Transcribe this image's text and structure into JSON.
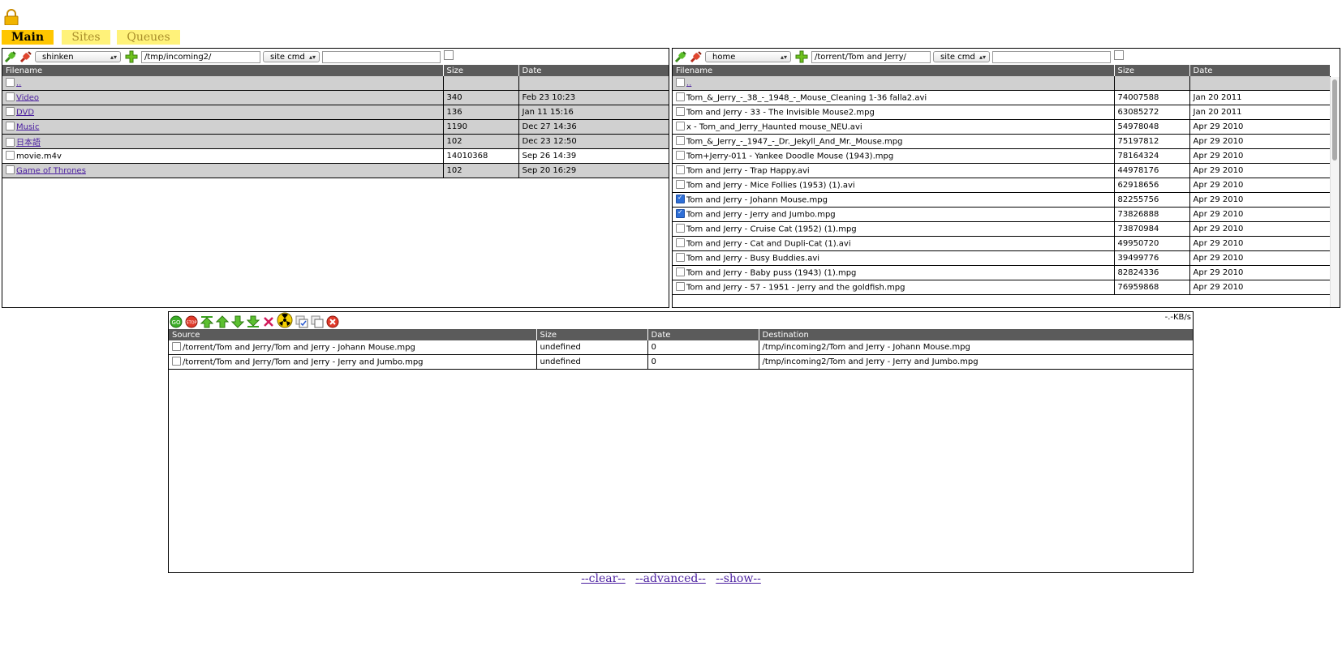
{
  "tabs": [
    {
      "label": "Main",
      "active": true
    },
    {
      "label": "Sites",
      "active": false
    },
    {
      "label": "Queues",
      "active": false
    }
  ],
  "left_panel": {
    "site": "shinken",
    "path": "/tmp/incoming2/",
    "cmd": "site cmd",
    "cmd_input": "",
    "columns": [
      "Filename",
      "Size",
      "Date"
    ],
    "parent": "..",
    "rows": [
      {
        "name": "Video",
        "size": "340",
        "date": "Feb 23 10:23",
        "dir": true
      },
      {
        "name": "DVD",
        "size": "136",
        "date": "Jan 11 15:16",
        "dir": true
      },
      {
        "name": "Music",
        "size": "1190",
        "date": "Dec 27 14:36",
        "dir": true
      },
      {
        "name": "日本語",
        "size": "102",
        "date": "Dec 23 12:50",
        "dir": true
      },
      {
        "name": "movie.m4v",
        "size": "14010368",
        "date": "Sep 26 14:39",
        "dir": false
      },
      {
        "name": "Game of Thrones",
        "size": "102",
        "date": "Sep 20 16:29",
        "dir": true
      }
    ]
  },
  "right_panel": {
    "site": "home",
    "path": "/torrent/Tom and Jerry/",
    "cmd": "site cmd",
    "cmd_input": "",
    "columns": [
      "Filename",
      "Size",
      "Date"
    ],
    "parent": "..",
    "rows": [
      {
        "name": "Tom_&_Jerry_-_38_-_1948_-_Mouse_Cleaning 1-36 falla2.avi",
        "size": "74007588",
        "date": "Jan 20 2011",
        "checked": false
      },
      {
        "name": "Tom and Jerry - 33 - The Invisible Mouse2.mpg",
        "size": "63085272",
        "date": "Jan 20 2011",
        "checked": false
      },
      {
        "name": "x - Tom_and_Jerry_Haunted mouse_NEU.avi",
        "size": "54978048",
        "date": "Apr 29 2010",
        "checked": false
      },
      {
        "name": "Tom_&_Jerry_-_1947_-_Dr._Jekyll_And_Mr._Mouse.mpg",
        "size": "75197812",
        "date": "Apr 29 2010",
        "checked": false
      },
      {
        "name": "Tom+Jerry-011 - Yankee Doodle Mouse (1943).mpg",
        "size": "78164324",
        "date": "Apr 29 2010",
        "checked": false
      },
      {
        "name": "Tom and Jerry - Trap Happy.avi",
        "size": "44978176",
        "date": "Apr 29 2010",
        "checked": false
      },
      {
        "name": "Tom and Jerry - Mice Follies (1953) (1).avi",
        "size": "62918656",
        "date": "Apr 29 2010",
        "checked": false
      },
      {
        "name": "Tom and Jerry - Johann Mouse.mpg",
        "size": "82255756",
        "date": "Apr 29 2010",
        "checked": true
      },
      {
        "name": "Tom and Jerry - Jerry and Jumbo.mpg",
        "size": "73826888",
        "date": "Apr 29 2010",
        "checked": true
      },
      {
        "name": "Tom and Jerry - Cruise Cat (1952) (1).mpg",
        "size": "73870984",
        "date": "Apr 29 2010",
        "checked": false
      },
      {
        "name": "Tom and Jerry - Cat and Dupli-Cat (1).avi",
        "size": "49950720",
        "date": "Apr 29 2010",
        "checked": false
      },
      {
        "name": "Tom and Jerry - Busy Buddies.avi",
        "size": "39499776",
        "date": "Apr 29 2010",
        "checked": false
      },
      {
        "name": "Tom and Jerry - Baby puss (1943) (1).mpg",
        "size": "82824336",
        "date": "Apr 29 2010",
        "checked": false
      },
      {
        "name": "Tom and Jerry - 57 - 1951 - Jerry and the goldfish.mpg",
        "size": "76959868",
        "date": "Apr 29 2010",
        "checked": false
      }
    ]
  },
  "queue": {
    "speed": "-.-KB/s",
    "columns": [
      "Source",
      "Size",
      "Date",
      "Destination"
    ],
    "rows": [
      {
        "source": "/torrent/Tom and Jerry/Tom and Jerry - Johann Mouse.mpg",
        "size": "undefined",
        "date": "0",
        "dest": "/tmp/incoming2/Tom and Jerry - Johann Mouse.mpg"
      },
      {
        "source": "/torrent/Tom and Jerry/Tom and Jerry - Jerry and Jumbo.mpg",
        "size": "undefined",
        "date": "0",
        "dest": "/tmp/incoming2/Tom and Jerry - Jerry and Jumbo.mpg"
      }
    ]
  },
  "footer_links": [
    "--clear--",
    "--advanced--",
    "--show--"
  ],
  "colors": {
    "tab_active": "#ffc600",
    "tab_inactive": "#fff27a",
    "header_bg": "#5b5b5b",
    "dir_row": "#d0d0d0",
    "link": "#4b1fa0"
  }
}
